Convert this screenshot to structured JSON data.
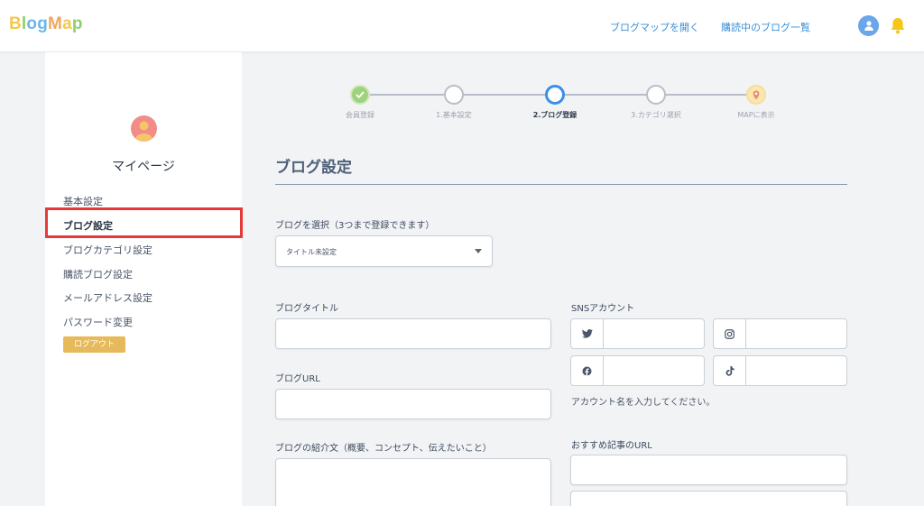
{
  "header": {
    "logo_letters": [
      {
        "ch": "B",
        "color": "#f2c94c"
      },
      {
        "ch": "l",
        "color": "#8fcf6b"
      },
      {
        "ch": "o",
        "color": "#6ab7e8"
      },
      {
        "ch": "g",
        "color": "#6ab7e8"
      },
      {
        "ch": "M",
        "color": "#f2a65a"
      },
      {
        "ch": "a",
        "color": "#f2c94c"
      },
      {
        "ch": "p",
        "color": "#8fcf6b"
      }
    ],
    "nav": {
      "open_map": "ブログマップを開く",
      "subscribed_list": "購読中のブログ一覧"
    },
    "icons": {
      "account": "user-avatar-icon",
      "notifications": "bell-icon"
    },
    "accent_color": "#3a8fd4"
  },
  "sidebar": {
    "title": "マイページ",
    "items": [
      {
        "label": "基本設定"
      },
      {
        "label": "ブログ設定",
        "active": true
      },
      {
        "label": "ブログカテゴリ設定"
      },
      {
        "label": "購読ブログ設定"
      },
      {
        "label": "メールアドレス設定"
      },
      {
        "label": "パスワード変更"
      }
    ],
    "logout_label": "ログアウト",
    "highlight_color": "#e63a3a"
  },
  "stepper": {
    "steps": [
      {
        "label": "会員登録",
        "state": "done"
      },
      {
        "label": "1.基本設定",
        "state": "todo"
      },
      {
        "label": "2.ブログ登録",
        "state": "current"
      },
      {
        "label": "3.カテゴリ選択",
        "state": "todo"
      },
      {
        "label": "MAPに表示",
        "state": "map"
      }
    ]
  },
  "form": {
    "section_title": "ブログ設定",
    "select_label": "ブログを選択（3つまで登録できます）",
    "select_value": "タイトル未設定",
    "blog_title_label": "ブログタイトル",
    "blog_title_value": "",
    "blog_url_label": "ブログURL",
    "blog_url_value": "",
    "intro_label": "ブログの紹介文（概要、コンセプト、伝えたいこと）",
    "intro_value": "",
    "sns_label": "SNSアカウント",
    "sns": [
      {
        "service": "twitter-icon",
        "value": ""
      },
      {
        "service": "instagram-icon",
        "value": ""
      },
      {
        "service": "facebook-icon",
        "value": ""
      },
      {
        "service": "tiktok-icon",
        "value": ""
      }
    ],
    "sns_hint": "アカウント名を入力してください。",
    "recommended_label": "おすすめ記事のURL",
    "recommended_values": [
      "",
      ""
    ]
  }
}
